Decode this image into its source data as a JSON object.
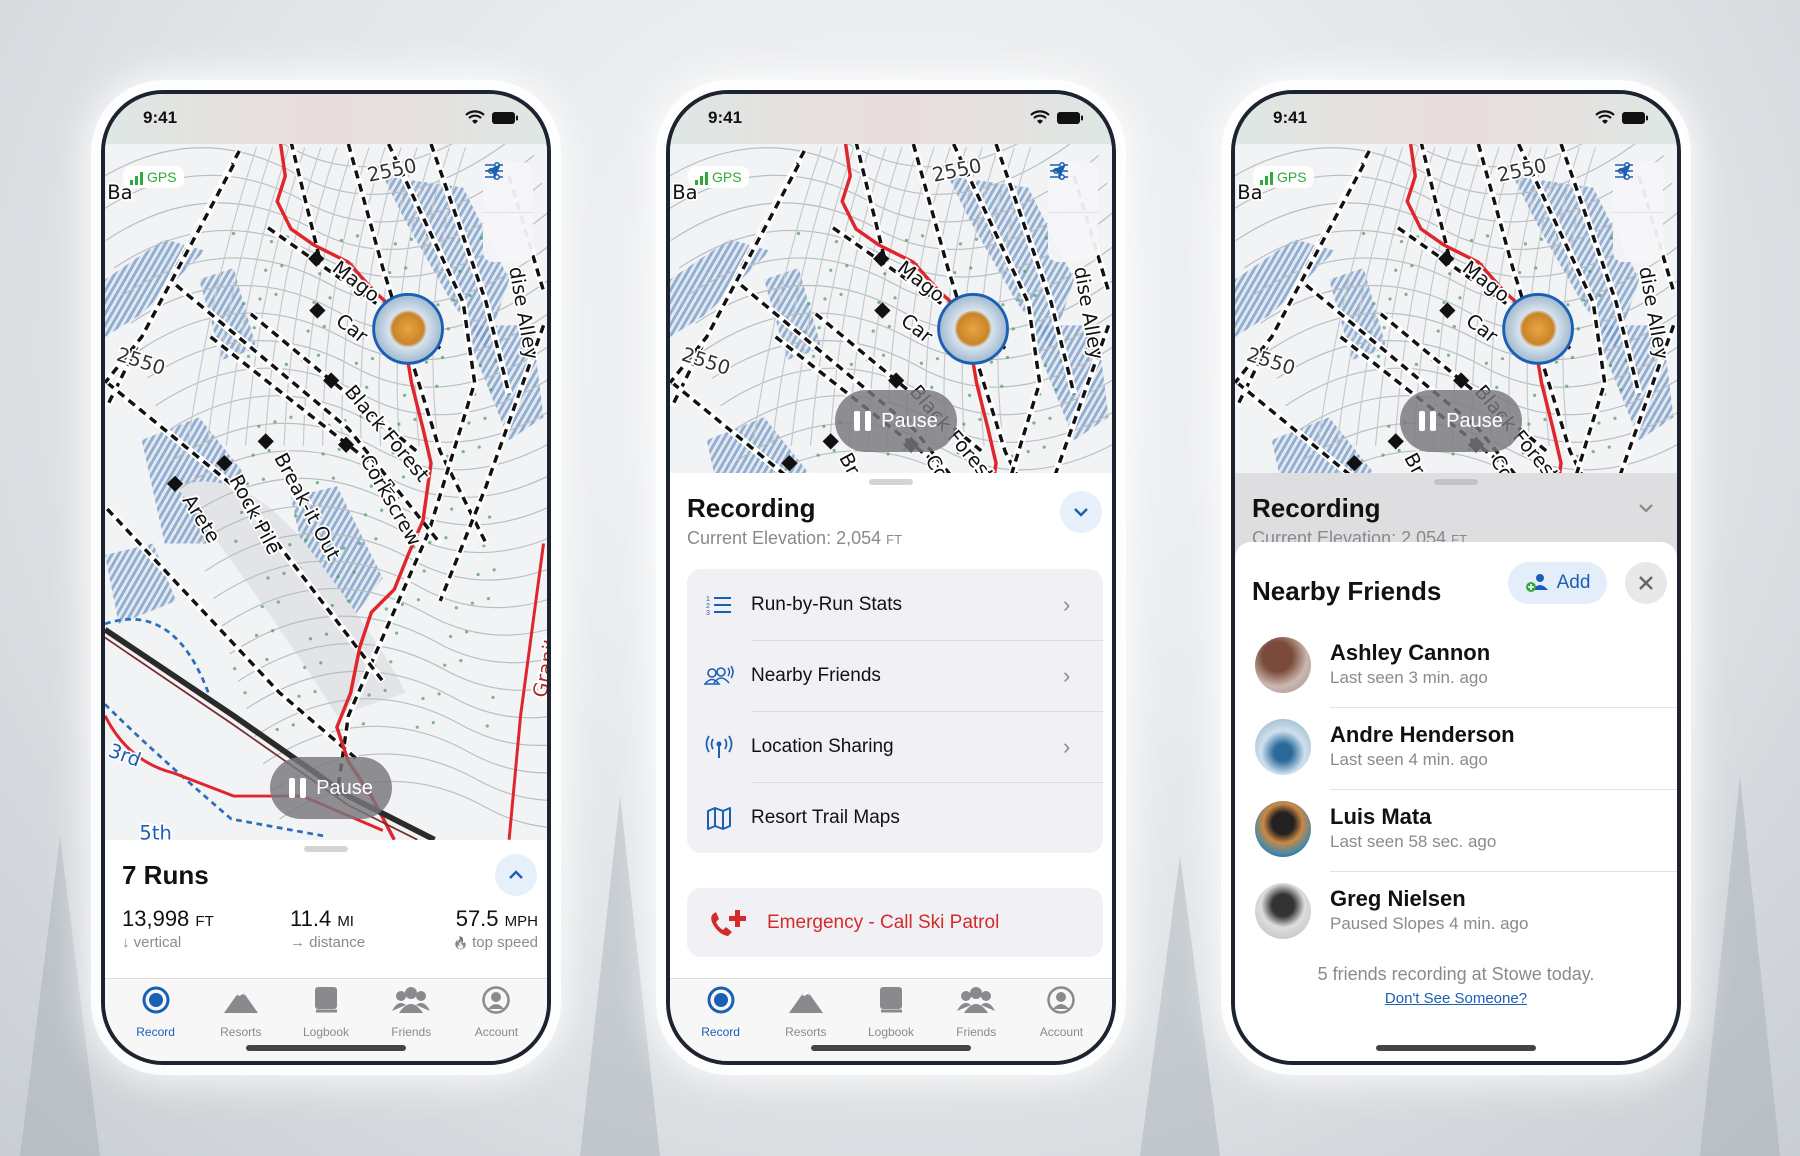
{
  "status": {
    "time": "9:41"
  },
  "map": {
    "gps": "GPS",
    "pause": "Pause",
    "labels": {
      "contour_a": "2550",
      "contour_b": "2550",
      "mago": "Mago",
      "car": "Car",
      "black_forest": "Black Forest",
      "corkscrew": "Corkscrew",
      "break_it_out": "Break-it Out",
      "rock_pile": "Rock Pile",
      "arete": "Arete",
      "paradise_alley": "dise Alley",
      "granite_chief": "Granite Chief",
      "third": "3rd",
      "fifth": "5th",
      "basin": "Ba"
    }
  },
  "tabs": [
    {
      "label": "Record",
      "icon": "record-icon",
      "active": true
    },
    {
      "label": "Resorts",
      "icon": "mountain-icon"
    },
    {
      "label": "Logbook",
      "icon": "book-icon"
    },
    {
      "label": "Friends",
      "icon": "friends-icon"
    },
    {
      "label": "Account",
      "icon": "account-icon"
    }
  ],
  "phone1": {
    "title": "7 Runs",
    "stats": [
      {
        "value": "13,998",
        "unit": "FT",
        "label": "vertical",
        "icon": "↓"
      },
      {
        "value": "11.4",
        "unit": "MI",
        "label": "distance",
        "icon": "→"
      },
      {
        "value": "57.5",
        "unit": "MPH",
        "label": "top speed",
        "icon": "🔥"
      }
    ]
  },
  "phone2": {
    "title": "Recording",
    "elevation": "Current Elevation: 2,054",
    "elevation_unit": "FT",
    "menu": [
      {
        "label": "Run-by-Run Stats",
        "icon": "numbered-list-icon"
      },
      {
        "label": "Nearby Friends",
        "icon": "nearby-friends-icon"
      },
      {
        "label": "Location Sharing",
        "icon": "antenna-icon"
      },
      {
        "label": "Resort Trail Maps",
        "icon": "map-icon"
      }
    ],
    "emergency": "Emergency - Call Ski Patrol"
  },
  "phone3": {
    "title": "Nearby Friends",
    "add": "Add",
    "friends": [
      {
        "name": "Ashley Cannon",
        "status": "Last seen 3 min. ago"
      },
      {
        "name": "Andre Henderson",
        "status": "Last seen 4 min. ago"
      },
      {
        "name": "Luis Mata",
        "status": "Last seen 58 sec. ago"
      },
      {
        "name": "Greg Nielsen",
        "status": "Paused Slopes 4 min. ago"
      }
    ],
    "footer": "5 friends recording at Stowe today.",
    "link": "Don't See Someone?"
  },
  "colors": {
    "accent": "#1b5fb4",
    "danger": "#d42a2a",
    "gps": "#2eaa3c",
    "route": "#e0262d"
  }
}
